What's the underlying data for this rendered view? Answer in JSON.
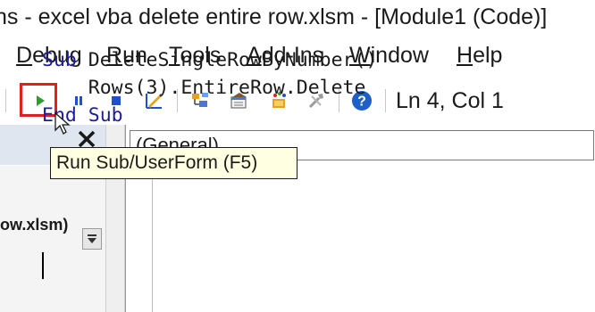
{
  "window": {
    "title": "ns - excel vba delete entire row.xlsm - [Module1 (Code)]"
  },
  "menu": {
    "items": [
      {
        "label": "Debug",
        "accel": "D",
        "rest": "ebug"
      },
      {
        "label": "Run",
        "accel": "R",
        "rest": "un"
      },
      {
        "label": "Tools",
        "accel": "T",
        "rest": "ools"
      },
      {
        "label": "Add-Ins",
        "accel": "A",
        "rest": "dd-Ins"
      },
      {
        "label": "Window",
        "accel": "W",
        "rest": "indow"
      },
      {
        "label": "Help",
        "accel": "H",
        "rest": "elp"
      }
    ]
  },
  "toolbar": {
    "buttons": [
      "run-icon",
      "pause-icon",
      "stop-icon",
      "design-mode-icon",
      "project-explorer-icon",
      "properties-icon",
      "object-browser-icon",
      "toolbox-icon",
      "help-icon"
    ],
    "position_status": "Ln 4, Col 1",
    "accent_run": "#2e9c2e",
    "highlight_color": "#e0201f"
  },
  "tooltip": {
    "text": "Run Sub/UserForm (F5)"
  },
  "project_pane": {
    "file_label": "ow.xlsm)"
  },
  "code_window": {
    "object_combo": "(General)",
    "lines": [
      {
        "kw1": "Sub",
        "text": " DeleteSingleRowByNumber()",
        "kw2": ""
      },
      {
        "kw1": "",
        "text": "    Rows(3).EntireRow.Delete",
        "kw2": ""
      },
      {
        "kw1": "End",
        "text": " ",
        "kw2": "Sub"
      }
    ],
    "keyword_color": "#1c1c9c"
  }
}
